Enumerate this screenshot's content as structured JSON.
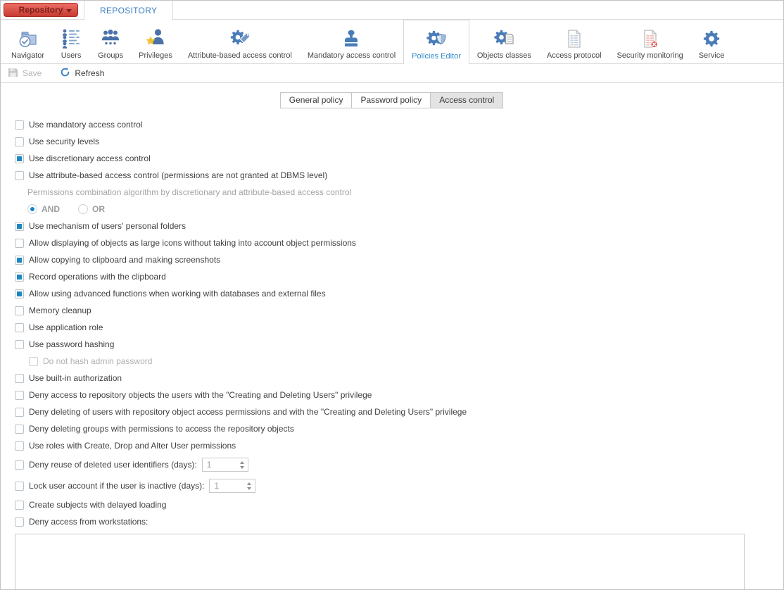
{
  "app_tabs": {
    "repository_button": "Repository",
    "repository_tab": "REPOSITORY"
  },
  "ribbon": {
    "items": [
      {
        "label": "Navigator",
        "icon": "navigator-icon",
        "selected": false
      },
      {
        "label": "Users",
        "icon": "users-icon",
        "selected": false
      },
      {
        "label": "Groups",
        "icon": "groups-icon",
        "selected": false
      },
      {
        "label": "Privileges",
        "icon": "privileges-icon",
        "selected": false
      },
      {
        "label": "Attribute-based access control",
        "icon": "attribute-based-access-control-icon",
        "selected": false
      },
      {
        "label": "Mandatory access control",
        "icon": "mandatory-access-control-icon",
        "selected": false
      },
      {
        "label": "Policies Editor",
        "icon": "policies-editor-icon",
        "selected": true
      },
      {
        "label": "Objects classes",
        "icon": "objects-classes-icon",
        "selected": false
      },
      {
        "label": "Access protocol",
        "icon": "access-protocol-icon",
        "selected": false
      },
      {
        "label": "Security monitoring",
        "icon": "security-monitoring-icon",
        "selected": false
      },
      {
        "label": "Service",
        "icon": "service-icon",
        "selected": false
      }
    ]
  },
  "toolbar": {
    "save": "Save",
    "save_enabled": false,
    "refresh": "Refresh",
    "refresh_enabled": true
  },
  "policy_tabs": [
    {
      "label": "General policy",
      "active": false
    },
    {
      "label": "Password policy",
      "active": false
    },
    {
      "label": "Access control",
      "active": true
    }
  ],
  "settings": {
    "items": [
      {
        "type": "checkbox",
        "label": "Use mandatory access control",
        "checked": false
      },
      {
        "type": "checkbox",
        "label": "Use security levels",
        "checked": false
      },
      {
        "type": "checkbox",
        "label": "Use discretionary access control",
        "checked": true
      },
      {
        "type": "checkbox",
        "label": "Use attribute-based access control (permissions are not granted at DBMS level)",
        "checked": false
      },
      {
        "type": "note",
        "label": "Permissions combination algorithm by discretionary and attribute-based access control"
      },
      {
        "type": "radio-group",
        "options": [
          {
            "label": "AND",
            "selected": true
          },
          {
            "label": "OR",
            "selected": false
          }
        ]
      },
      {
        "type": "checkbox",
        "label": "Use mechanism of users' personal folders",
        "checked": true
      },
      {
        "type": "checkbox",
        "label": "Allow displaying of objects as large icons without taking into account object permissions",
        "checked": false
      },
      {
        "type": "checkbox",
        "label": "Allow copying to clipboard and making screenshots",
        "checked": true
      },
      {
        "type": "checkbox",
        "label": "Record operations with the clipboard",
        "checked": true
      },
      {
        "type": "checkbox",
        "label": "Allow using advanced functions when working with databases and external files",
        "checked": true
      },
      {
        "type": "checkbox",
        "label": "Memory cleanup",
        "checked": false
      },
      {
        "type": "checkbox",
        "label": "Use application role",
        "checked": false
      },
      {
        "type": "checkbox",
        "label": "Use password hashing",
        "checked": false
      },
      {
        "type": "checkbox",
        "label": "Do not hash admin password",
        "checked": false,
        "disabled": true,
        "indent": true
      },
      {
        "type": "checkbox",
        "label": "Use built-in authorization",
        "checked": false
      },
      {
        "type": "checkbox",
        "label": "Deny access to repository objects the users with the \"Creating and Deleting Users\" privilege",
        "checked": false
      },
      {
        "type": "checkbox",
        "label": "Deny deleting of users with repository object access permissions and with the \"Creating and Deleting Users\" privilege",
        "checked": false
      },
      {
        "type": "checkbox",
        "label": "Deny deleting groups with permissions to access the repository objects",
        "checked": false
      },
      {
        "type": "checkbox",
        "label": "Use roles with Create, Drop and Alter User permissions",
        "checked": false
      },
      {
        "type": "checkbox-number",
        "label": "Deny reuse of deleted user identifiers (days):",
        "checked": false,
        "value": "1",
        "input_disabled": true
      },
      {
        "type": "checkbox-number",
        "label": "Lock user account if the user is inactive (days):",
        "checked": false,
        "value": "1",
        "input_disabled": true
      },
      {
        "type": "checkbox",
        "label": "Create subjects with delayed loading",
        "checked": false
      },
      {
        "type": "checkbox",
        "label": "Deny access from workstations:",
        "checked": false
      },
      {
        "type": "textarea",
        "value": ""
      }
    ]
  },
  "colors": {
    "accent_blue": "#2e8bca",
    "tab_text_blue": "#3b7ec0",
    "checkbox_blue": "#1d87c2",
    "repository_button_red": "#c63a31",
    "disabled_text_gray": "#a5a5a5",
    "border_gray": "#dadada",
    "active_segment_gray": "#e3e3e3",
    "security_badge_red": "#d9534f"
  }
}
